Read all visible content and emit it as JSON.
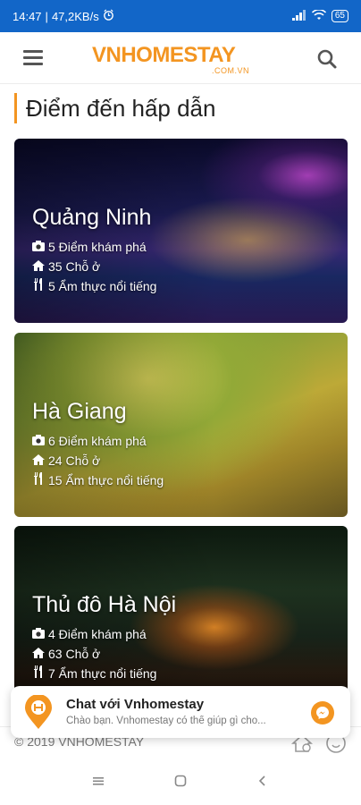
{
  "status_bar": {
    "time": "14:47",
    "network_speed": "47,2KB/s",
    "battery": "65"
  },
  "header": {
    "logo_main": "VNHOMESTAY",
    "logo_sub": ".COM.VN",
    "menu_icon": "hamburger-icon",
    "search_icon": "search-icon"
  },
  "section": {
    "title": "Điểm đến hấp dẫn"
  },
  "destinations": [
    {
      "name": "Quảng Ninh",
      "places": "5 Điểm khám phá",
      "stays": "35 Chỗ ở",
      "foods": "5 Ẩm thực nổi tiếng"
    },
    {
      "name": "Hà Giang",
      "places": "6 Điểm khám phá",
      "stays": "24 Chỗ ở",
      "foods": "15 Ẩm thực nổi tiếng"
    },
    {
      "name": "Thủ đô Hà Nội",
      "places": "4 Điểm khám phá",
      "stays": "63 Chỗ ở",
      "foods": "7 Ẩm thực nổi tiếng"
    }
  ],
  "footer": {
    "copyright": "© 2019 VNHOMESTAY"
  },
  "chat": {
    "title": "Chat với Vnhomestay",
    "subtitle": "Chào bạn. Vnhomestay có thể giúp gì cho...",
    "icon": "messenger-icon"
  },
  "colors": {
    "brand": "#f39521",
    "status_bar": "#1266c8"
  }
}
